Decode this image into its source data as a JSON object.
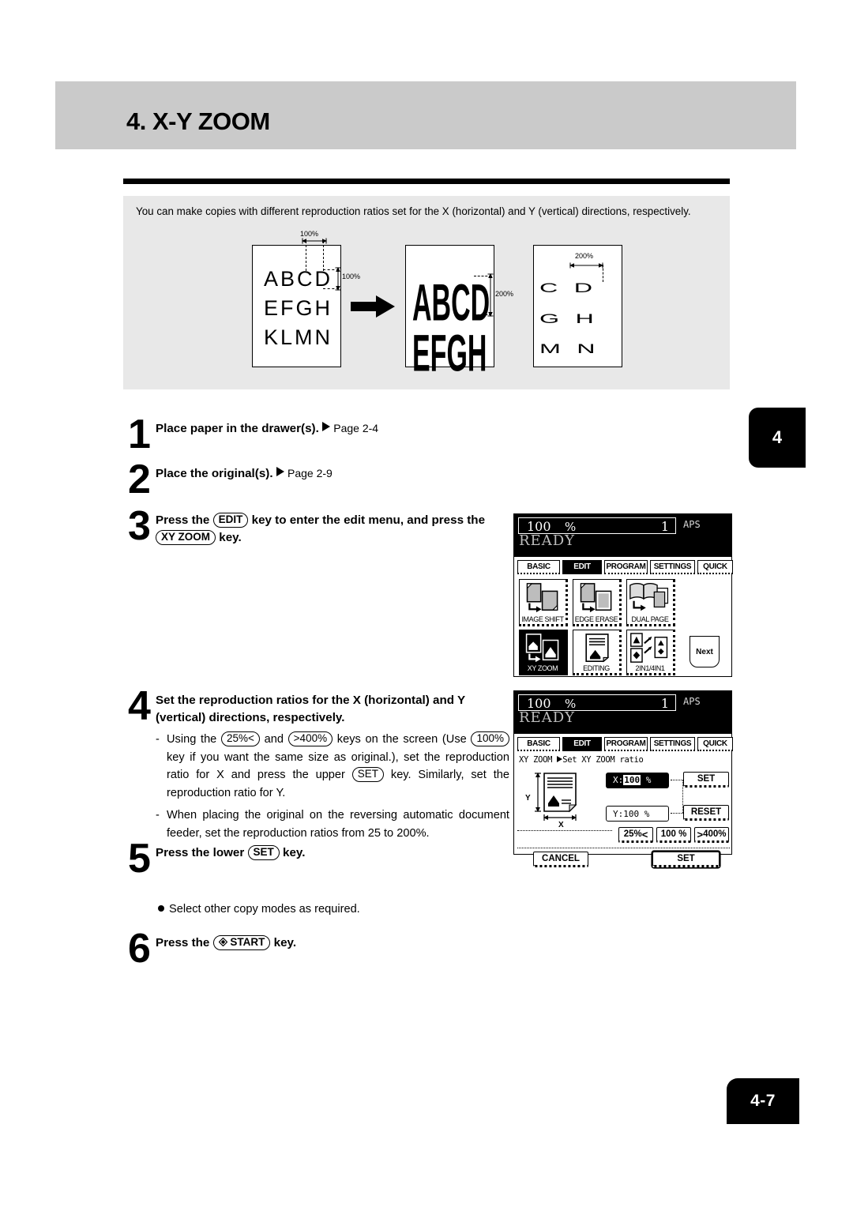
{
  "header": {
    "title": "4. X-Y ZOOM",
    "chapter_tab": "4",
    "page_tab": "4-7"
  },
  "intro": {
    "text": "You can make copies with different reproduction ratios set for the X (horizontal) and Y (vertical) directions, respectively."
  },
  "illustration": {
    "original": {
      "rows": [
        "ABCD",
        "EFGH",
        "KLMN"
      ],
      "width_label": "100%",
      "height_label": "100%"
    },
    "result_y": {
      "rows": [
        "ABCD",
        "EFGH"
      ],
      "height_label": "200%"
    },
    "result_x": {
      "rows": [
        "C D",
        "G H",
        "M N"
      ],
      "width_label": "200%"
    }
  },
  "steps": [
    {
      "num": "1",
      "text_bold": "Place paper in the drawer(s).",
      "ref": "Page 2-4"
    },
    {
      "num": "2",
      "text_bold": "Place the original(s).",
      "ref": "Page 2-9"
    },
    {
      "num": "3",
      "line1_a": "Press the",
      "key1": "EDIT",
      "line1_b": "key to enter the edit menu, and press",
      "line2_a": "the",
      "key2": "XY ZOOM",
      "line2_b": "key."
    },
    {
      "num": "4",
      "line1": "Set the reproduction ratios for the X (horizontal) and",
      "line2": "Y (vertical) directions, respectively."
    },
    {
      "num": "5",
      "a": "Press the lower",
      "key": "SET",
      "b": "key."
    },
    {
      "num": "6",
      "a": "Press the",
      "key": "START",
      "key_icon": "start-diamond-icon",
      "b": "key."
    }
  ],
  "notes": {
    "dash": "-",
    "note1_p1": "Using the",
    "note1_k1": "25%<",
    "note1_p2": "and",
    "note1_k2": ">400%",
    "note1_p3": "keys on the screen (Use",
    "note1_k3": "100%",
    "note1_p4": "key if you want the same size as original.), set the reproduction ratio for X and press the upper",
    "note1_k4": "SET",
    "note1_p5": "key. Similarly, set the reproduction ratio for Y.",
    "note2": "When placing the original on the reversing automatic document feeder, set the reproduction ratios from 25 to 200%."
  },
  "bullet": {
    "text": "Select other copy modes as required."
  },
  "lcd1": {
    "status": {
      "ratio": "100",
      "percent": "%",
      "copies": "1",
      "paper_mode": "APS",
      "state": "READY"
    },
    "tabs": [
      {
        "label": "BASIC",
        "selected": false
      },
      {
        "label": "EDIT",
        "selected": true
      },
      {
        "label": "PROGRAM",
        "selected": false
      },
      {
        "label": "SETTINGS",
        "selected": false
      },
      {
        "label": "QUICK",
        "selected": false
      }
    ],
    "functions": [
      {
        "label": "IMAGE SHIFT",
        "selected": false,
        "icon": "image-shift-icon"
      },
      {
        "label": "EDGE ERASE",
        "selected": false,
        "icon": "edge-erase-icon"
      },
      {
        "label": "DUAL PAGE",
        "selected": false,
        "icon": "dual-page-icon"
      },
      {
        "label": "XY ZOOM",
        "selected": true,
        "icon": "xy-zoom-icon"
      },
      {
        "label": "EDITING",
        "selected": false,
        "icon": "editing-icon"
      },
      {
        "label": "2IN1/4IN1",
        "selected": false,
        "icon": "2in1-4in1-icon"
      }
    ],
    "next_label": "Next"
  },
  "lcd2": {
    "status": {
      "ratio": "100",
      "percent": "%",
      "copies": "1",
      "paper_mode": "APS",
      "state": "READY"
    },
    "tabs": [
      {
        "label": "BASIC",
        "selected": false
      },
      {
        "label": "EDIT",
        "selected": true
      },
      {
        "label": "PROGRAM",
        "selected": false
      },
      {
        "label": "SETTINGS",
        "selected": false
      },
      {
        "label": "QUICK",
        "selected": false
      }
    ],
    "breadcrumb_mode": "XY ZOOM",
    "breadcrumb_sub": "Set XY ZOOM ratio",
    "x_field": {
      "label": "X:",
      "value": "100",
      "unit": "%",
      "selected": true
    },
    "y_field": {
      "label": "Y:",
      "value": "100",
      "unit": "%",
      "selected": false
    },
    "set_upper": "SET",
    "reset": "RESET",
    "zoom_down": "25%",
    "zoom_down_icon": "<",
    "zoom_100": "100 %",
    "zoom_up_icon": ">",
    "zoom_up": "400%",
    "cancel": "CANCEL",
    "set_lower": "SET",
    "axis_y": "Y",
    "axis_x": "X"
  }
}
